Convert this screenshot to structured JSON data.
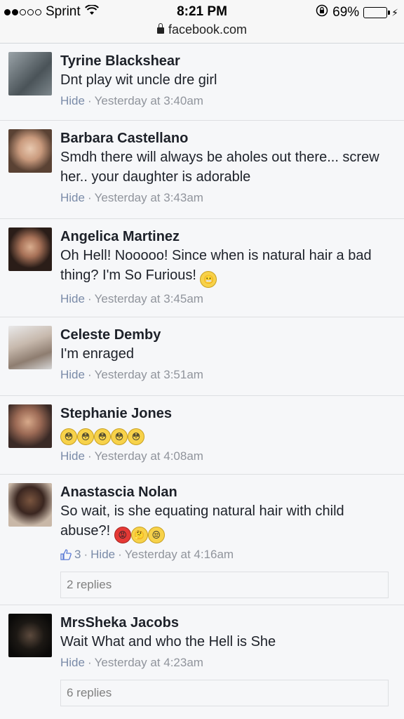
{
  "status_bar": {
    "carrier": "Sprint",
    "time": "8:21 PM",
    "battery": "69%",
    "battery_level": 0.69,
    "url": "facebook.com"
  },
  "comments": [
    {
      "name": "Tyrine Blackshear",
      "text": "Dnt play wit uncle dre girl",
      "hide": "Hide",
      "time": "Yesterday at 3:40am"
    },
    {
      "name": "Barbara Castellano",
      "text": "Smdh there will always be aholes out there... screw her.. your daughter is adorable",
      "hide": "Hide",
      "time": "Yesterday at 3:43am"
    },
    {
      "name": "Angelica Martinez",
      "text": "Oh Hell! Nooooo! Since when is natural hair a bad thing? I'm So Furious!",
      "hide": "Hide",
      "time": "Yesterday at 3:45am"
    },
    {
      "name": "Celeste Demby",
      "text": "I'm enraged",
      "hide": "Hide",
      "time": "Yesterday at 3:51am"
    },
    {
      "name": "Stephanie Jones",
      "hide": "Hide",
      "time": "Yesterday at 4:08am"
    },
    {
      "name": "Anastascia Nolan",
      "text": "So wait, is she equating natural hair with child abuse?!",
      "likes": "3",
      "hide": "Hide",
      "time": "Yesterday at 4:16am",
      "replies": "2 replies"
    },
    {
      "name": "MrsSheka Jacobs",
      "text": "Wait What and who the Hell is She",
      "hide": "Hide",
      "time": "Yesterday at 4:23am",
      "replies": "6 replies"
    }
  ]
}
